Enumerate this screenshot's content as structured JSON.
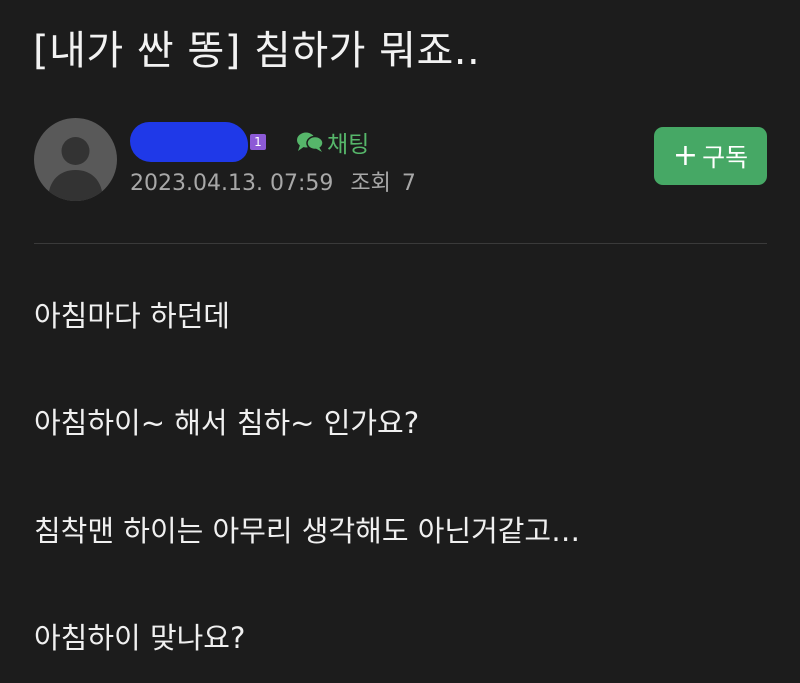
{
  "post": {
    "title": "[내가 싼 똥] 침하가 뭐죠..",
    "author": {
      "name_redacted": "",
      "level_badge": "1",
      "chat_label": "채팅"
    },
    "meta": {
      "date": "2023.04.13. 07:59",
      "views_label": "조회",
      "views_count": "7"
    },
    "subscribe": {
      "icon": "+",
      "label": "구독"
    },
    "body": [
      "아침마다 하던데",
      "아침하이~ 해서 침하~ 인가요?",
      "침착맨 하이는 아무리 생각해도 아닌거같고…",
      "아침하이 맞나요?"
    ]
  },
  "icons": {
    "avatar": "default-user-silhouette",
    "chat": "chat-bubbles-icon"
  },
  "colors": {
    "background": "#1c1c1c",
    "text": "#f0f0f0",
    "meta_text": "#a8a8a8",
    "accent_green": "#46a865",
    "chat_green": "#56b66a",
    "level_badge": "#8c5ad6",
    "redaction": "#1f39e8",
    "divider": "#3a3a3a"
  }
}
